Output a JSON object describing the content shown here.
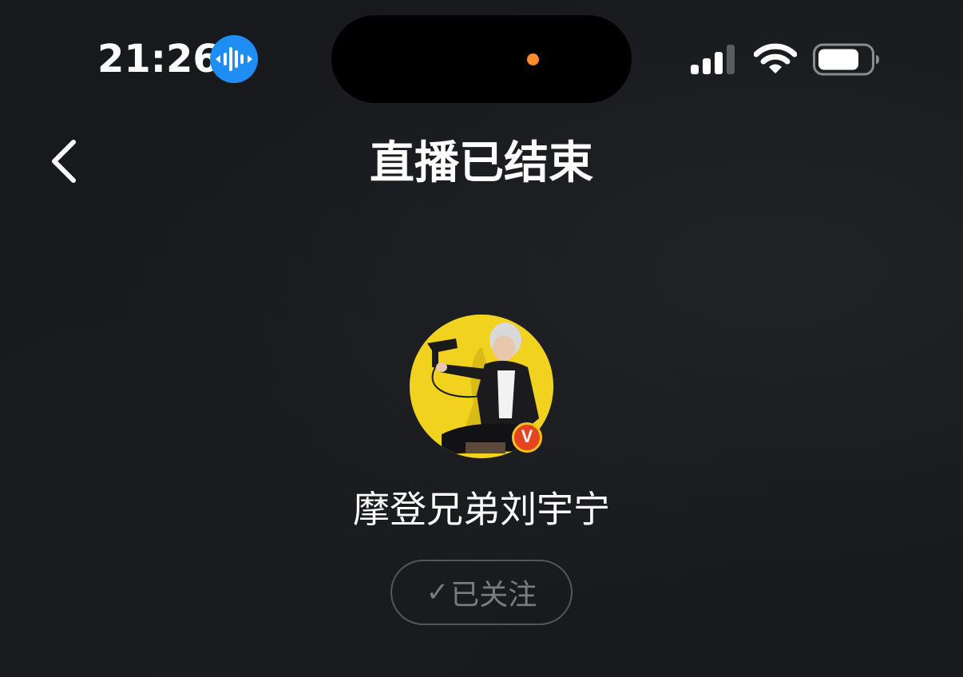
{
  "status_bar": {
    "time": "21:26",
    "audio_indicator": "waveform-icon",
    "signal_icon": "cellular-signal-icon",
    "wifi_icon": "wifi-icon",
    "battery_icon": "battery-icon",
    "privacy_dot_color": "#ff8c2a",
    "audio_badge_color": "#1e8ef5"
  },
  "header": {
    "back_icon": "chevron-left-icon",
    "title": "直播已结束"
  },
  "profile": {
    "avatar_icon": "avatar-photo",
    "verified_badge": "V",
    "verified_color": "#e6441f",
    "name": "摩登兄弟刘宇宁",
    "follow_check": "✓",
    "follow_label": "已关注"
  }
}
